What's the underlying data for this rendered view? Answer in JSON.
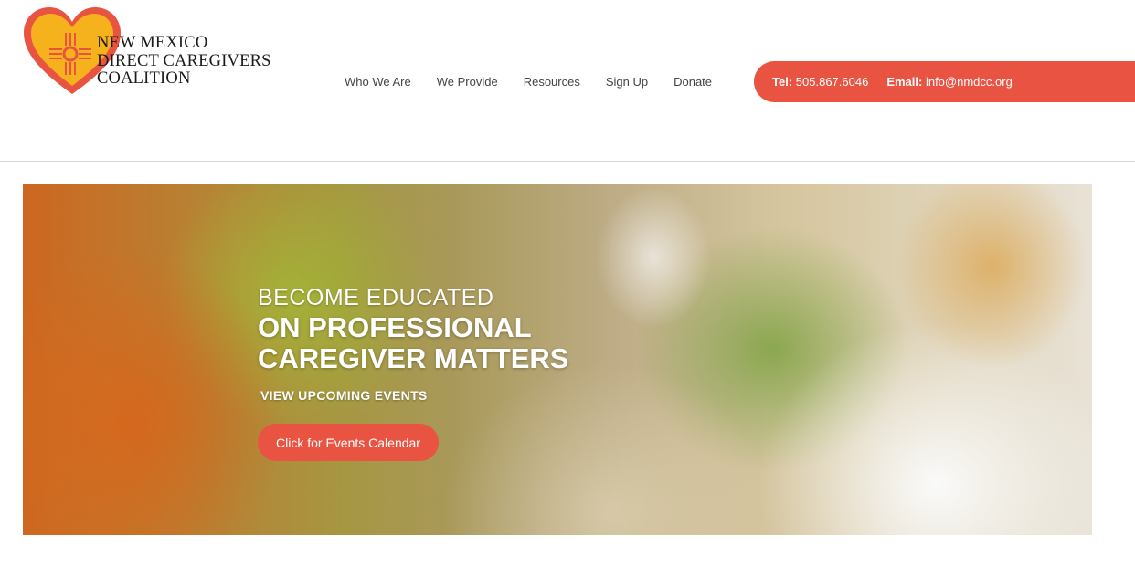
{
  "logo": {
    "line1": "NEW MEXICO",
    "line2": "DIRECT CAREGIVERS",
    "line3": "COALITION",
    "heart_color": "#e85342",
    "heart_fill": "#f6b21d"
  },
  "nav": {
    "items": [
      {
        "label": "Who We Are"
      },
      {
        "label": "We Provide"
      },
      {
        "label": "Resources"
      },
      {
        "label": "Sign Up"
      },
      {
        "label": "Donate"
      }
    ]
  },
  "contact": {
    "tel_label": "Tel:",
    "tel_value": "505.867.6046",
    "email_label": "Email:",
    "email_value": "info@nmdcc.org",
    "accent_color": "#e85342"
  },
  "hero": {
    "kicker": "BECOME EDUCATED",
    "title_line1": "ON PROFESSIONAL",
    "title_line2": "CAREGIVER MATTERS",
    "subtitle": "VIEW UPCOMING EVENTS",
    "button_label": "Click for Events Calendar"
  }
}
